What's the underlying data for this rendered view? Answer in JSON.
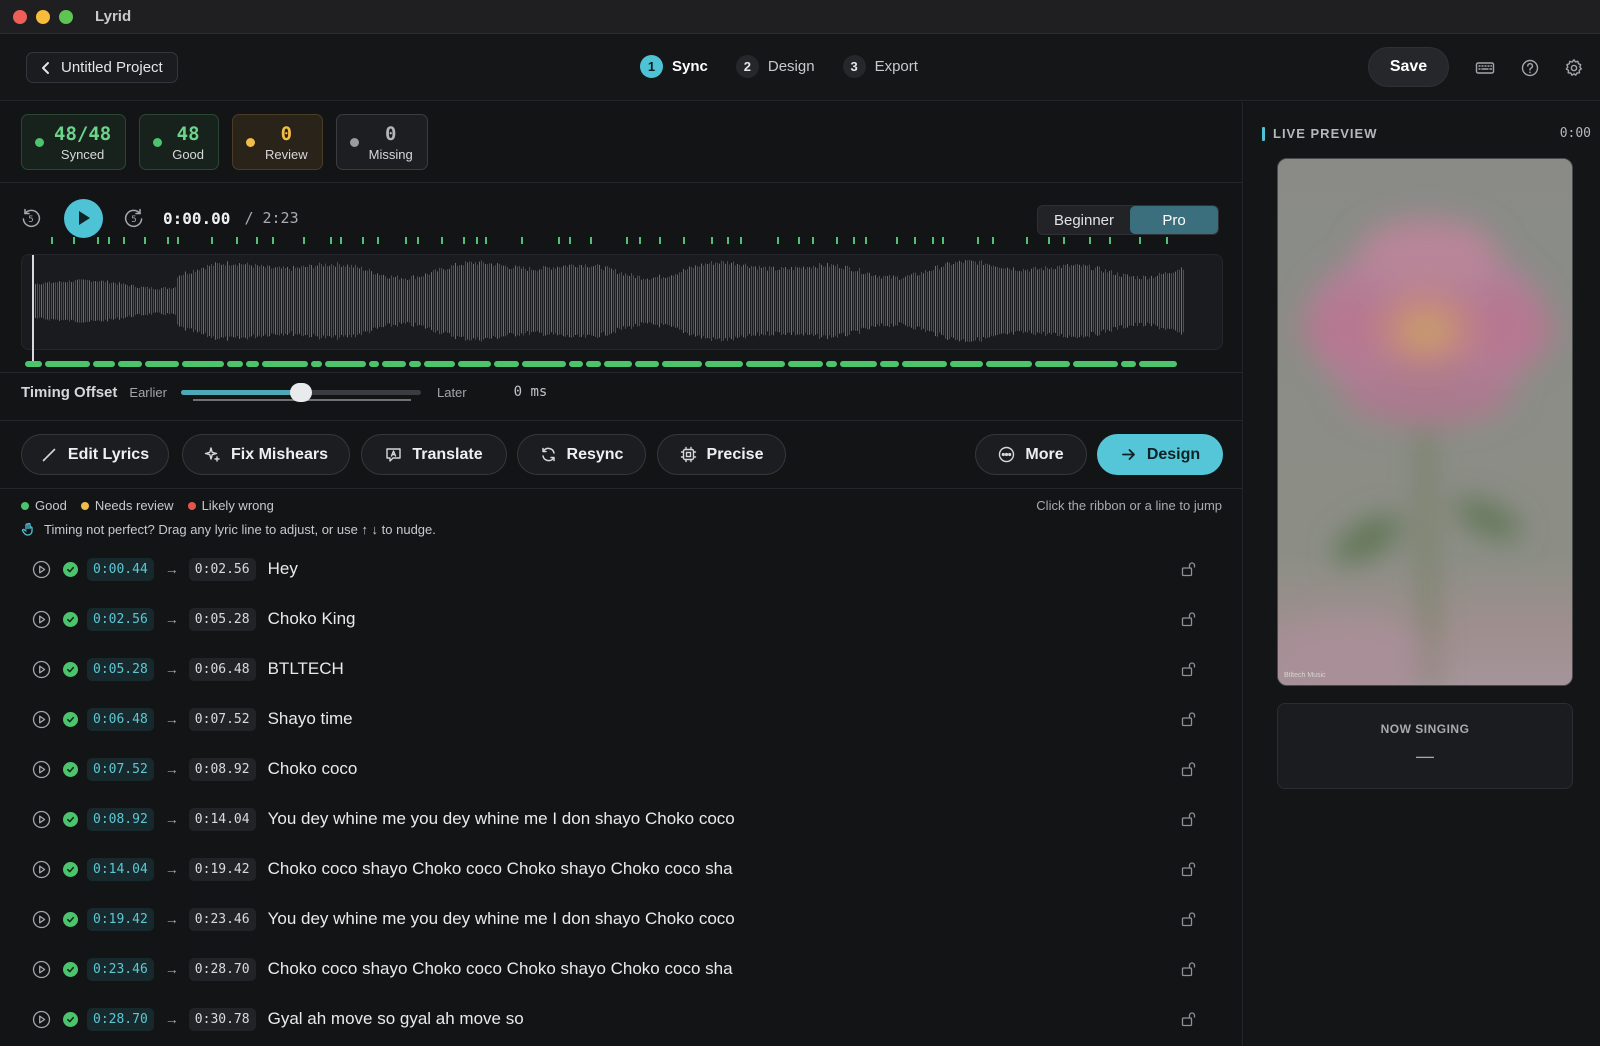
{
  "window": {
    "title": "Lyrid"
  },
  "header": {
    "back_label": "Untitled Project",
    "steps": [
      {
        "num": "1",
        "label": "Sync",
        "active": true
      },
      {
        "num": "2",
        "label": "Design",
        "active": false
      },
      {
        "num": "3",
        "label": "Export",
        "active": false
      }
    ],
    "save_label": "Save"
  },
  "stats": [
    {
      "value": "48/48",
      "label": "Synced",
      "status": "synced"
    },
    {
      "value": "48",
      "label": "Good",
      "status": "good"
    },
    {
      "value": "0",
      "label": "Review",
      "status": "review"
    },
    {
      "value": "0",
      "label": "Missing",
      "status": "missing"
    }
  ],
  "player": {
    "skip_back_seconds": "5",
    "skip_forward_seconds": "5",
    "current_time": "0:00.00",
    "total_time": "/ 2:23",
    "modes": [
      "Beginner",
      "Pro"
    ],
    "active_mode": "Pro"
  },
  "timing_offset": {
    "title": "Timing Offset",
    "earlier_label": "Earlier",
    "later_label": "Later",
    "value": "0 ms",
    "slider_fraction": 0.5
  },
  "actions": {
    "edit_lyrics": "Edit Lyrics",
    "fix_mishears": "Fix Mishears",
    "translate": "Translate",
    "resync": "Resync",
    "precise": "Precise",
    "more": "More",
    "design": "Design"
  },
  "legend": {
    "good": "Good",
    "needs_review": "Needs review",
    "likely_wrong": "Likely wrong",
    "hint": "Click the ribbon or a line to jump",
    "tip": "Timing not perfect? Drag any lyric line to adjust, or use ↑ ↓ to nudge."
  },
  "colors": {
    "accent": "#4fc3d6",
    "good": "#4cc46e",
    "review": "#f0be48",
    "wrong": "#e2574c",
    "missing": "#9a9ca3"
  },
  "lines": [
    {
      "start": "0:00.44",
      "end": "0:02.56",
      "text": "Hey"
    },
    {
      "start": "0:02.56",
      "end": "0:05.28",
      "text": "Choko King"
    },
    {
      "start": "0:05.28",
      "end": "0:06.48",
      "text": "BTLTECH"
    },
    {
      "start": "0:06.48",
      "end": "0:07.52",
      "text": "Shayo time"
    },
    {
      "start": "0:07.52",
      "end": "0:08.92",
      "text": "Choko coco"
    },
    {
      "start": "0:08.92",
      "end": "0:14.04",
      "text": "You dey whine me you dey whine me I don shayo Choko coco"
    },
    {
      "start": "0:14.04",
      "end": "0:19.42",
      "text": "Choko coco shayo Choko coco Choko shayo Choko coco sha"
    },
    {
      "start": "0:19.42",
      "end": "0:23.46",
      "text": "You dey whine me you dey whine me I don shayo Choko coco"
    },
    {
      "start": "0:23.46",
      "end": "0:28.70",
      "text": "Choko coco shayo Choko coco Choko shayo Choko coco sha"
    },
    {
      "start": "0:28.70",
      "end": "0:30.78",
      "text": "Gyal ah move so gyal ah move so"
    }
  ],
  "preview": {
    "title": "LIVE PREVIEW",
    "time": "0:00",
    "credit": "Btltech Music",
    "now_singing_label": "NOW SINGING",
    "now_singing_value": "—"
  }
}
